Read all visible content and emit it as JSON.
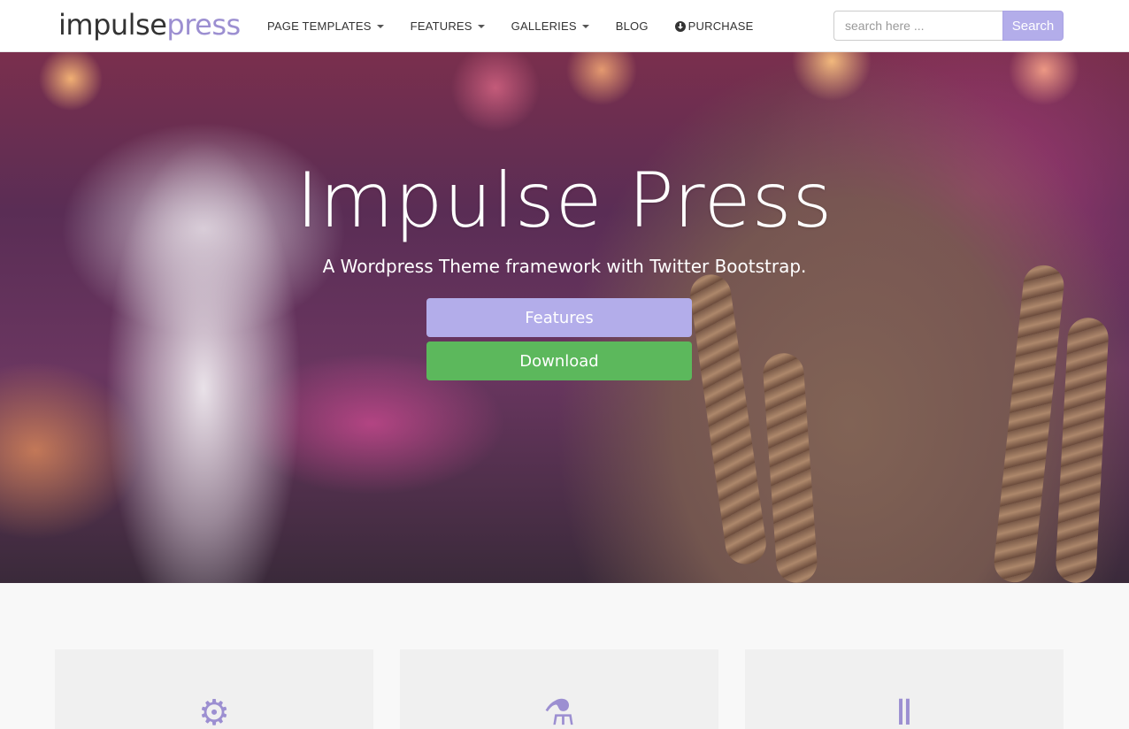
{
  "logo": {
    "part1": "impulse",
    "part2": "press"
  },
  "nav": {
    "items": [
      {
        "label": "PAGE TEMPLATES",
        "dropdown": true
      },
      {
        "label": "FEATURES",
        "dropdown": true
      },
      {
        "label": "GALLERIES",
        "dropdown": true
      },
      {
        "label": "BLOG",
        "dropdown": false
      },
      {
        "label": "PURCHASE",
        "dropdown": false,
        "icon": "download-circle-icon"
      }
    ]
  },
  "search": {
    "placeholder": "search here ...",
    "button_label": "Search"
  },
  "hero": {
    "title": "Impulse Press",
    "subtitle": "A Wordpress Theme framework with Twitter Bootstrap.",
    "features_button": "Features",
    "download_button": "Download"
  },
  "cards": [
    {
      "icon": "cog-icon"
    },
    {
      "icon": "flask-icon"
    },
    {
      "icon": "columns-icon"
    }
  ],
  "colors": {
    "accent": "#b3adea",
    "logo_accent": "#9c8fd1",
    "download": "#5cb85c"
  }
}
